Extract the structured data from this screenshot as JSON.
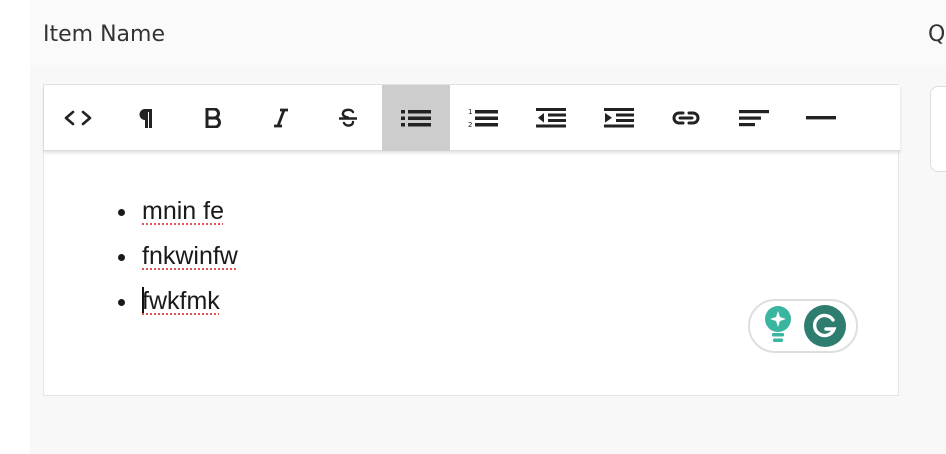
{
  "header": {
    "item_name": "Item Name",
    "quantity_header_partial": "Q"
  },
  "toolbar": {
    "buttons": [
      {
        "name": "code",
        "icon": "code-icon",
        "active": false
      },
      {
        "name": "paragraph",
        "icon": "pilcrow-icon",
        "active": false
      },
      {
        "name": "bold",
        "icon": "bold-icon",
        "active": false
      },
      {
        "name": "italic",
        "icon": "italic-icon",
        "active": false
      },
      {
        "name": "strikethrough",
        "icon": "strikethrough-icon",
        "active": false
      },
      {
        "name": "bullet-list",
        "icon": "bullet-list-icon",
        "active": true
      },
      {
        "name": "numbered-list",
        "icon": "numbered-list-icon",
        "active": false
      },
      {
        "name": "outdent",
        "icon": "outdent-icon",
        "active": false
      },
      {
        "name": "indent",
        "icon": "indent-icon",
        "active": false
      },
      {
        "name": "link",
        "icon": "link-icon",
        "active": false
      },
      {
        "name": "align-left",
        "icon": "align-left-icon",
        "active": false
      },
      {
        "name": "horizontal-rule",
        "icon": "horizontal-rule-icon",
        "active": false
      }
    ]
  },
  "editor": {
    "list_items": [
      "mnin fe",
      "fnkwinfw",
      "fwkfmk"
    ]
  },
  "grammarly": {
    "suggestion_icon": "lightbulb-sparkle-icon",
    "logo_icon": "grammarly-g-icon",
    "accent": "#2e7d6e",
    "bulb_color": "#3ab5a0"
  },
  "colors": {
    "active_button": "#cdcdcd",
    "spellcheck_underline": "#e05555"
  }
}
